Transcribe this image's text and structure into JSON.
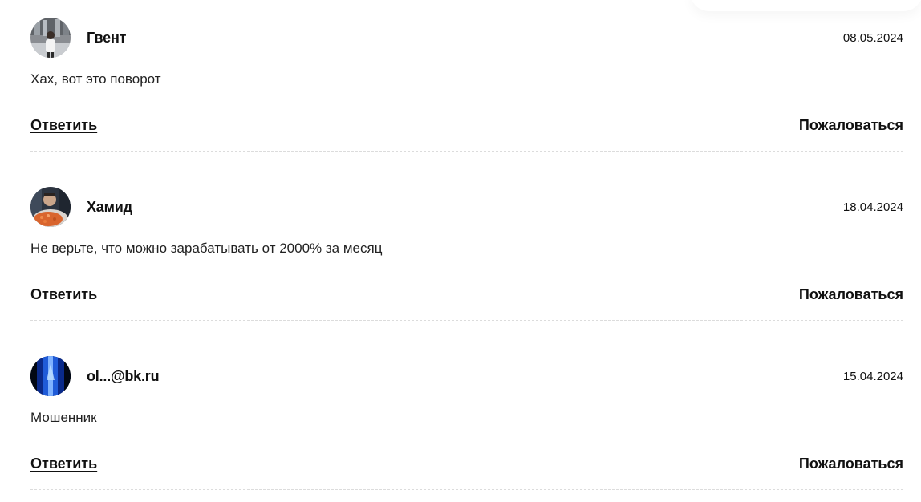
{
  "comments": [
    {
      "author": "Гвент",
      "date": "08.05.2024",
      "text": "Хах, вот это поворот",
      "reply_label": "Ответить",
      "complain_label": "Пожаловаться"
    },
    {
      "author": "Хамид",
      "date": "18.04.2024",
      "text": "Не верьте, что можно зарабатывать от 2000% за месяц",
      "reply_label": "Ответить",
      "complain_label": "Пожаловаться"
    },
    {
      "author": "ol...@bk.ru",
      "date": "15.04.2024",
      "text": "Мошенник",
      "reply_label": "Ответить",
      "complain_label": "Пожаловаться"
    }
  ]
}
